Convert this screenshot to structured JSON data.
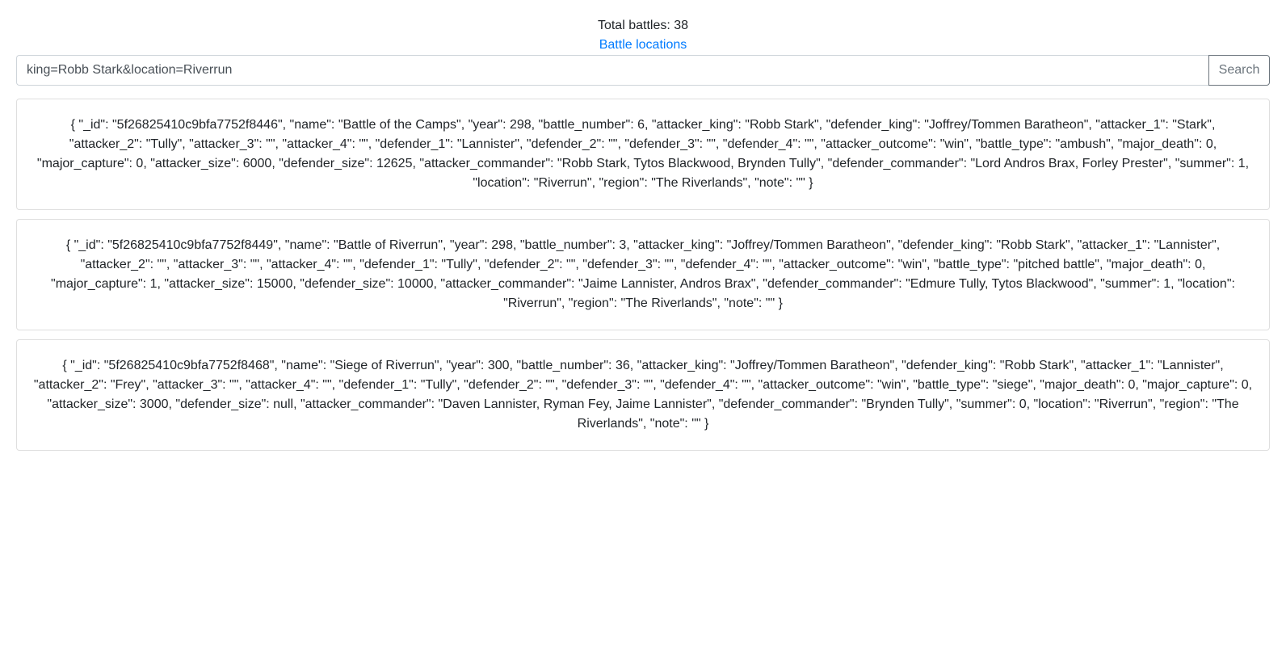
{
  "header": {
    "total_label": "Total battles: 38",
    "locations_link": "Battle locations"
  },
  "search": {
    "value": "king=Robb Stark&location=Riverrun",
    "button_label": "Search"
  },
  "results": [
    "{ \"_id\": \"5f26825410c9bfa7752f8446\", \"name\": \"Battle of the Camps\", \"year\": 298, \"battle_number\": 6, \"attacker_king\": \"Robb Stark\", \"defender_king\": \"Joffrey/Tommen Baratheon\", \"attacker_1\": \"Stark\", \"attacker_2\": \"Tully\", \"attacker_3\": \"\", \"attacker_4\": \"\", \"defender_1\": \"Lannister\", \"defender_2\": \"\", \"defender_3\": \"\", \"defender_4\": \"\", \"attacker_outcome\": \"win\", \"battle_type\": \"ambush\", \"major_death\": 0, \"major_capture\": 0, \"attacker_size\": 6000, \"defender_size\": 12625, \"attacker_commander\": \"Robb Stark, Tytos Blackwood, Brynden Tully\", \"defender_commander\": \"Lord Andros Brax, Forley Prester\", \"summer\": 1, \"location\": \"Riverrun\", \"region\": \"The Riverlands\", \"note\": \"\" }",
    "{ \"_id\": \"5f26825410c9bfa7752f8449\", \"name\": \"Battle of Riverrun\", \"year\": 298, \"battle_number\": 3, \"attacker_king\": \"Joffrey/Tommen Baratheon\", \"defender_king\": \"Robb Stark\", \"attacker_1\": \"Lannister\", \"attacker_2\": \"\", \"attacker_3\": \"\", \"attacker_4\": \"\", \"defender_1\": \"Tully\", \"defender_2\": \"\", \"defender_3\": \"\", \"defender_4\": \"\", \"attacker_outcome\": \"win\", \"battle_type\": \"pitched battle\", \"major_death\": 0, \"major_capture\": 1, \"attacker_size\": 15000, \"defender_size\": 10000, \"attacker_commander\": \"Jaime Lannister, Andros Brax\", \"defender_commander\": \"Edmure Tully, Tytos Blackwood\", \"summer\": 1, \"location\": \"Riverrun\", \"region\": \"The Riverlands\", \"note\": \"\" }",
    "{ \"_id\": \"5f26825410c9bfa7752f8468\", \"name\": \"Siege of Riverrun\", \"year\": 300, \"battle_number\": 36, \"attacker_king\": \"Joffrey/Tommen Baratheon\", \"defender_king\": \"Robb Stark\", \"attacker_1\": \"Lannister\", \"attacker_2\": \"Frey\", \"attacker_3\": \"\", \"attacker_4\": \"\", \"defender_1\": \"Tully\", \"defender_2\": \"\", \"defender_3\": \"\", \"defender_4\": \"\", \"attacker_outcome\": \"win\", \"battle_type\": \"siege\", \"major_death\": 0, \"major_capture\": 0, \"attacker_size\": 3000, \"defender_size\": null, \"attacker_commander\": \"Daven Lannister, Ryman Fey, Jaime Lannister\", \"defender_commander\": \"Brynden Tully\", \"summer\": 0, \"location\": \"Riverrun\", \"region\": \"The Riverlands\", \"note\": \"\" }"
  ]
}
